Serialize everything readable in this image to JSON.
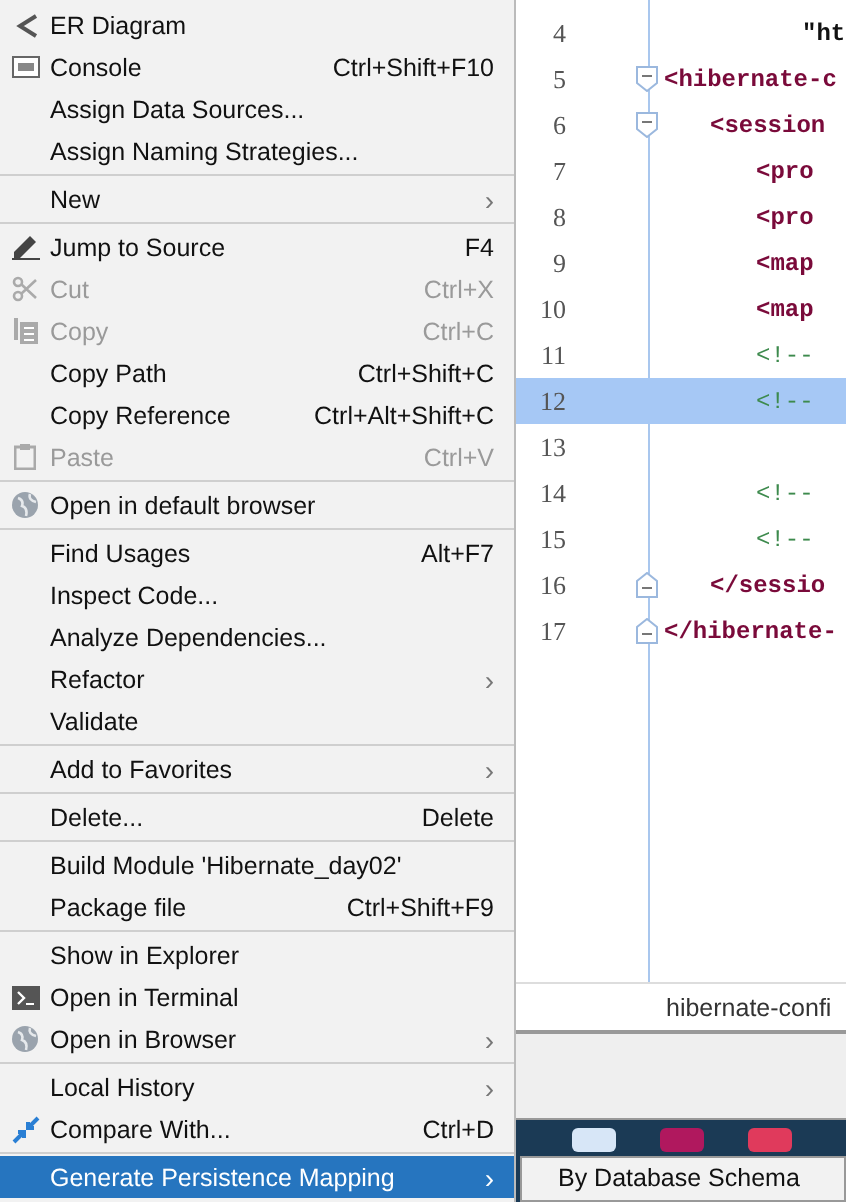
{
  "context_menu": {
    "groups": [
      {
        "items": [
          {
            "label": "ER Diagram",
            "kind": "er",
            "disabled": false,
            "selected": false
          },
          {
            "label": "Console",
            "kind": "console",
            "shortcut": "Ctrl+Shift+F10",
            "disabled": false,
            "selected": false
          },
          {
            "label": "Assign Data Sources...",
            "disabled": false,
            "selected": false
          },
          {
            "label": "Assign Naming Strategies...",
            "disabled": false,
            "selected": false
          }
        ]
      },
      {
        "items": [
          {
            "label": "New",
            "arrow": "›",
            "disabled": false,
            "selected": false
          }
        ]
      },
      {
        "items": [
          {
            "label": "Jump to Source",
            "kind": "edit",
            "shortcut": "F4",
            "disabled": false,
            "selected": false
          },
          {
            "label": "Cut",
            "kind": "cut",
            "shortcut": "Ctrl+X",
            "disabled": true,
            "selected": false
          },
          {
            "label": "Copy",
            "kind": "copy",
            "shortcut": "Ctrl+C",
            "disabled": true,
            "selected": false
          },
          {
            "label": "Copy Path",
            "shortcut": "Ctrl+Shift+C",
            "disabled": false,
            "selected": false
          },
          {
            "label": "Copy Reference",
            "shortcut": "Ctrl+Alt+Shift+C",
            "disabled": false,
            "selected": false
          },
          {
            "label": "Paste",
            "kind": "paste",
            "shortcut": "Ctrl+V",
            "disabled": true,
            "selected": false
          }
        ]
      },
      {
        "items": [
          {
            "label": "Open in default browser",
            "kind": "web",
            "disabled": false,
            "selected": false
          }
        ]
      },
      {
        "items": [
          {
            "label": "Find Usages",
            "shortcut": "Alt+F7",
            "disabled": false,
            "selected": false
          },
          {
            "label": "Inspect Code...",
            "disabled": false,
            "selected": false
          },
          {
            "label": "Analyze Dependencies...",
            "disabled": false,
            "selected": false
          },
          {
            "label": "Refactor",
            "arrow": "›",
            "disabled": false,
            "selected": false
          },
          {
            "label": "Validate",
            "disabled": false,
            "selected": false
          }
        ]
      },
      {
        "items": [
          {
            "label": "Add to Favorites",
            "arrow": "›",
            "disabled": false,
            "selected": false
          }
        ]
      },
      {
        "items": [
          {
            "label": "Delete...",
            "shortcut": "Delete",
            "disabled": false,
            "selected": false
          }
        ]
      },
      {
        "items": [
          {
            "label": "Build Module 'Hibernate_day02'",
            "disabled": false,
            "selected": false
          },
          {
            "label": "Package file",
            "shortcut": "Ctrl+Shift+F9",
            "disabled": false,
            "selected": false
          }
        ]
      },
      {
        "items": [
          {
            "label": "Show in Explorer",
            "disabled": false,
            "selected": false
          },
          {
            "label": "Open in Terminal",
            "kind": "terminal",
            "disabled": false,
            "selected": false
          },
          {
            "label": "Open in Browser",
            "kind": "web",
            "arrow": "›",
            "disabled": false,
            "selected": false
          }
        ]
      },
      {
        "items": [
          {
            "label": "Local History",
            "arrow": "›",
            "disabled": false,
            "selected": false
          },
          {
            "label": "Compare With...",
            "kind": "compare",
            "shortcut": "Ctrl+D",
            "disabled": false,
            "selected": false
          }
        ]
      },
      {
        "items": [
          {
            "label": "Generate Persistence Mapping",
            "arrow": "›",
            "disabled": false,
            "selected": true
          }
        ]
      }
    ]
  },
  "submenu": {
    "items": [
      "By Database Schema"
    ]
  },
  "editor": {
    "lines": [
      {
        "number": "4",
        "kind": "string",
        "code": "\"ht",
        "highlighted": false
      },
      {
        "number": "5",
        "kind": "tag",
        "code": "<hibernate-c",
        "highlighted": false
      },
      {
        "number": "6",
        "kind": "tag",
        "code": "<session",
        "highlighted": false
      },
      {
        "number": "7",
        "kind": "tag",
        "code": "<pro",
        "highlighted": false
      },
      {
        "number": "8",
        "kind": "tag",
        "code": "<pro",
        "highlighted": false
      },
      {
        "number": "9",
        "kind": "tag",
        "code": "<map",
        "highlighted": false
      },
      {
        "number": "10",
        "kind": "tag",
        "code": "<map",
        "highlighted": false
      },
      {
        "number": "11",
        "kind": "comment",
        "code": "<!--",
        "highlighted": false
      },
      {
        "number": "12",
        "kind": "comment",
        "code": "<!--",
        "highlighted": true
      },
      {
        "number": "13",
        "kind": "blank",
        "highlighted": false
      },
      {
        "number": "14",
        "kind": "comment",
        "code": "<!--",
        "highlighted": false
      },
      {
        "number": "15",
        "kind": "comment",
        "code": "<!--",
        "highlighted": false
      },
      {
        "number": "16",
        "kind": "tag",
        "code": "</sessio",
        "highlighted": false
      },
      {
        "number": "17",
        "kind": "tag",
        "code": "</hibernate-",
        "highlighted": false
      }
    ],
    "tab": "hibernate-confi"
  }
}
